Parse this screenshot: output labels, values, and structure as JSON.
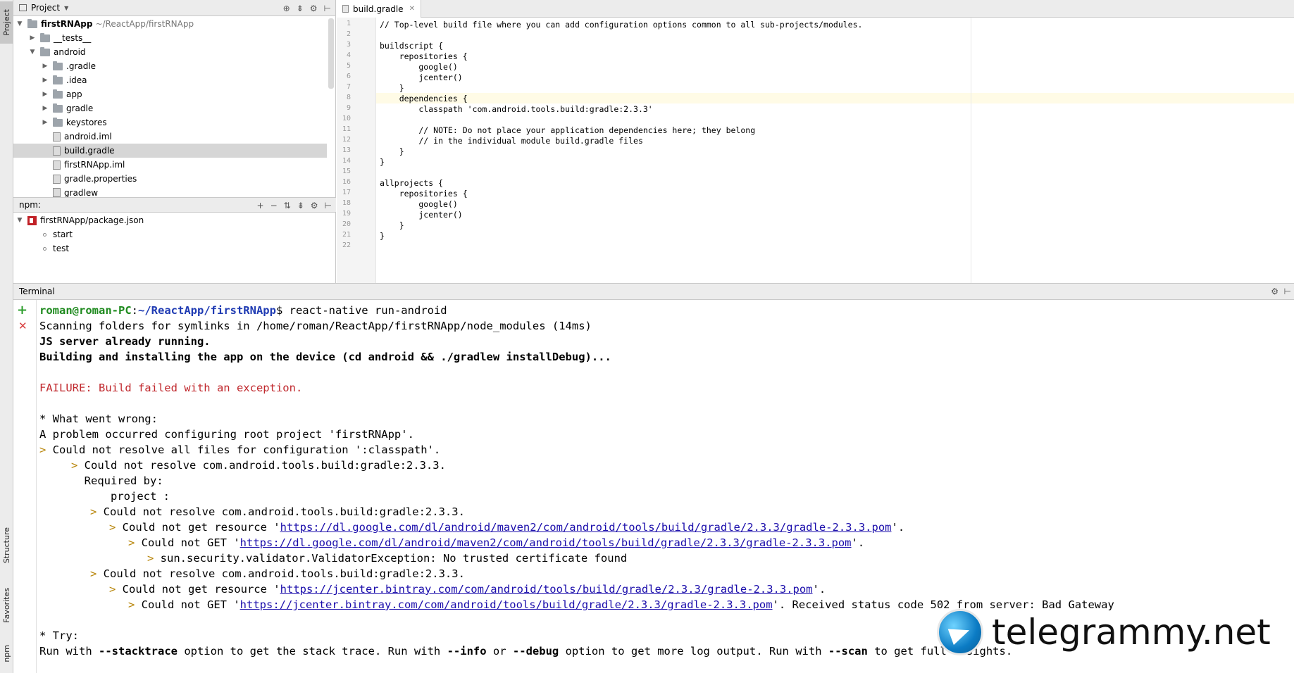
{
  "sidebar_tabs": {
    "project": "Project",
    "structure": "Structure",
    "favorites": "Favorites",
    "npm": "npm"
  },
  "project_panel": {
    "title": "Project",
    "tree": [
      {
        "label": "firstRNApp",
        "hint": "~/ReactApp/firstRNApp"
      },
      {
        "label": "__tests__"
      },
      {
        "label": "android"
      },
      {
        "label": ".gradle"
      },
      {
        "label": ".idea"
      },
      {
        "label": "app"
      },
      {
        "label": "gradle"
      },
      {
        "label": "keystores"
      },
      {
        "label": "android.iml"
      },
      {
        "label": "build.gradle"
      },
      {
        "label": "firstRNApp.iml"
      },
      {
        "label": "gradle.properties"
      },
      {
        "label": "gradlew"
      }
    ]
  },
  "npm_panel": {
    "title": "npm:",
    "package": "firstRNApp/package.json",
    "scripts": [
      "start",
      "test"
    ]
  },
  "editor": {
    "tab_label": "build.gradle",
    "lines": [
      "// Top-level build file where you can add configuration options common to all sub-projects/modules.",
      "",
      "buildscript {",
      "    repositories {",
      "        google()",
      "        jcenter()",
      "    }",
      "    dependencies {",
      "        classpath 'com.android.tools.build:gradle:2.3.3'",
      "",
      "        // NOTE: Do not place your application dependencies here; they belong",
      "        // in the individual module build.gradle files",
      "    }",
      "}",
      "",
      "allprojects {",
      "    repositories {",
      "        google()",
      "        jcenter()",
      "    }",
      "}",
      ""
    ]
  },
  "terminal": {
    "title": "Terminal",
    "prompt_user": "roman@roman-PC",
    "prompt_sep": ":",
    "prompt_path": "~/ReactApp/firstRNApp",
    "prompt_end": "$ ",
    "command": "react-native run-android",
    "l1": "Scanning folders for symlinks in /home/roman/ReactApp/firstRNApp/node_modules (14ms)",
    "l2": "JS server already running.",
    "l3": "Building and installing the app on the device (cd android && ./gradlew installDebug)...",
    "l4": "FAILURE: Build failed with an exception.",
    "l5": "* What went wrong:",
    "l6": "A problem occurred configuring root project 'firstRNApp'.",
    "l7": "Could not resolve all files for configuration ':classpath'.",
    "l8": "Could not resolve com.android.tools.build:gradle:2.3.3.",
    "l9": "Required by:",
    "l10": "project :",
    "l11": "Could not resolve com.android.tools.build:gradle:2.3.3.",
    "l12_pre": "Could not get resource '",
    "l12_url": "https://dl.google.com/dl/android/maven2/com/android/tools/build/gradle/2.3.3/gradle-2.3.3.pom",
    "l12_post": "'.",
    "l13_pre": "Could not GET '",
    "l13_url": "https://dl.google.com/dl/android/maven2/com/android/tools/build/gradle/2.3.3/gradle-2.3.3.pom",
    "l13_post": "'.",
    "l14": "sun.security.validator.ValidatorException: No trusted certificate found",
    "l15": "Could not resolve com.android.tools.build:gradle:2.3.3.",
    "l16_pre": "Could not get resource '",
    "l16_url": "https://jcenter.bintray.com/com/android/tools/build/gradle/2.3.3/gradle-2.3.3.pom",
    "l16_post": "'.",
    "l17_pre": "Could not GET '",
    "l17_url": "https://jcenter.bintray.com/com/android/tools/build/gradle/2.3.3/gradle-2.3.3.pom",
    "l17_post": "'. Received status code 502 from server: Bad Gateway",
    "l18": "* Try:",
    "l19": {
      "a": "Run with ",
      "b": "--stacktrace",
      "c": " option to get the stack trace. Run with ",
      "d": "--info",
      "e": " or ",
      "f": "--debug",
      "g": " option to get more log output. Run with ",
      "h": "--scan",
      "i": " to get full insights."
    }
  },
  "watermark": "telegrammy.net",
  "colors": {
    "failure": "#c0282d",
    "prompt_user": "#1e8a1e",
    "prompt_path": "#1f3bb3",
    "link": "#1a0dab"
  }
}
